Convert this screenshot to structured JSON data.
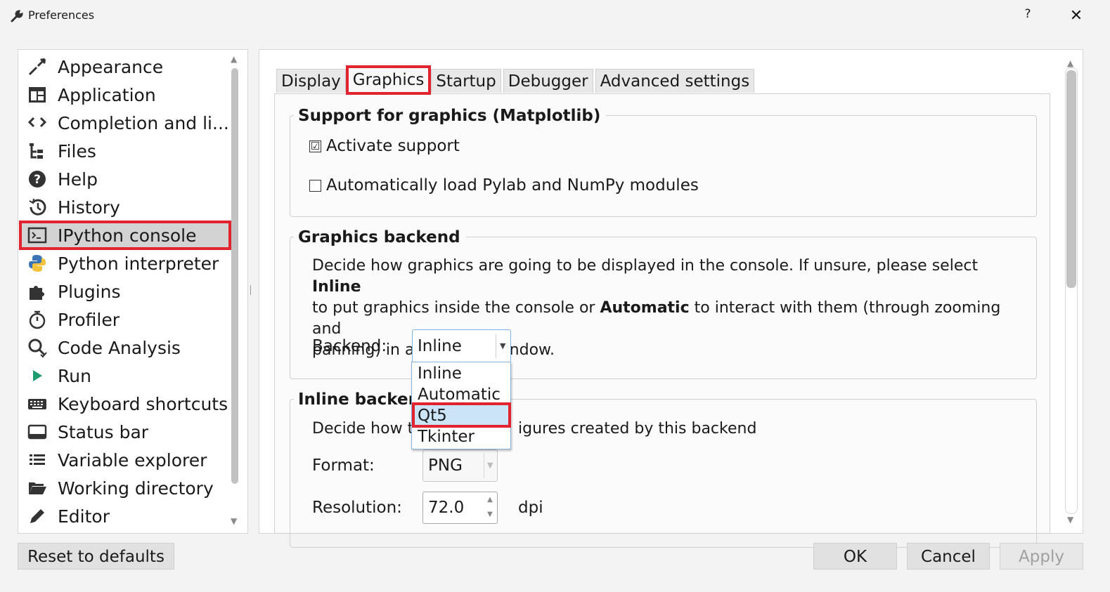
{
  "window": {
    "title": "Preferences",
    "help": "?",
    "close": "✕"
  },
  "sidebar": {
    "items": [
      {
        "label": "Appearance",
        "icon": "paintbrush-icon"
      },
      {
        "label": "Application",
        "icon": "layout-icon"
      },
      {
        "label": "Completion and li...",
        "icon": "completion-icon"
      },
      {
        "label": "Files",
        "icon": "file-tree-icon"
      },
      {
        "label": "Help",
        "icon": "help-circle-icon"
      },
      {
        "label": "History",
        "icon": "history-icon"
      },
      {
        "label": "IPython console",
        "icon": "terminal-icon",
        "selected": true
      },
      {
        "label": "Python interpreter",
        "icon": "python-icon"
      },
      {
        "label": "Plugins",
        "icon": "puzzle-icon"
      },
      {
        "label": "Profiler",
        "icon": "stopwatch-icon"
      },
      {
        "label": "Code Analysis",
        "icon": "code-analysis-icon"
      },
      {
        "label": "Run",
        "icon": "play-icon"
      },
      {
        "label": "Keyboard shortcuts",
        "icon": "keyboard-icon"
      },
      {
        "label": "Status bar",
        "icon": "statusbar-icon"
      },
      {
        "label": "Variable explorer",
        "icon": "list-icon"
      },
      {
        "label": "Working directory",
        "icon": "folder-open-icon"
      },
      {
        "label": "Editor",
        "icon": "pencil-icon"
      }
    ]
  },
  "tabs": [
    {
      "label": "Display"
    },
    {
      "label": "Graphics",
      "active": true
    },
    {
      "label": "Startup"
    },
    {
      "label": "Debugger"
    },
    {
      "label": "Advanced settings"
    }
  ],
  "graphics_support": {
    "title": "Support for graphics (Matplotlib)",
    "activate_label": "Activate support",
    "activate_checked": "☑",
    "autoload_label": "Automatically load Pylab and NumPy modules"
  },
  "backend_group": {
    "title": "Graphics backend",
    "desc_1": "Decide how graphics are going to be displayed in the console. If unsure, please select ",
    "desc_bold_1": "Inline",
    "desc_2": "to put graphics inside the console or ",
    "desc_bold_2": "Automatic",
    "desc_3": " to interact with them (through zooming and",
    "desc_4": "panning) in a separate window.",
    "backend_label": "Backend:",
    "backend_value": "Inline",
    "options": [
      "Inline",
      "Automatic",
      "Qt5",
      "Tkinter"
    ],
    "highlighted_option": "Qt5"
  },
  "inline_group": {
    "title": "Inline backend",
    "desc_left": "Decide how to",
    "desc_right": "igures created by this backend",
    "format_label": "Format:",
    "format_value": "PNG",
    "resolution_label": "Resolution:",
    "resolution_value": "72.0",
    "resolution_unit": "dpi"
  },
  "buttons": {
    "reset": "Reset to defaults",
    "ok": "OK",
    "cancel": "Cancel",
    "apply": "Apply"
  }
}
